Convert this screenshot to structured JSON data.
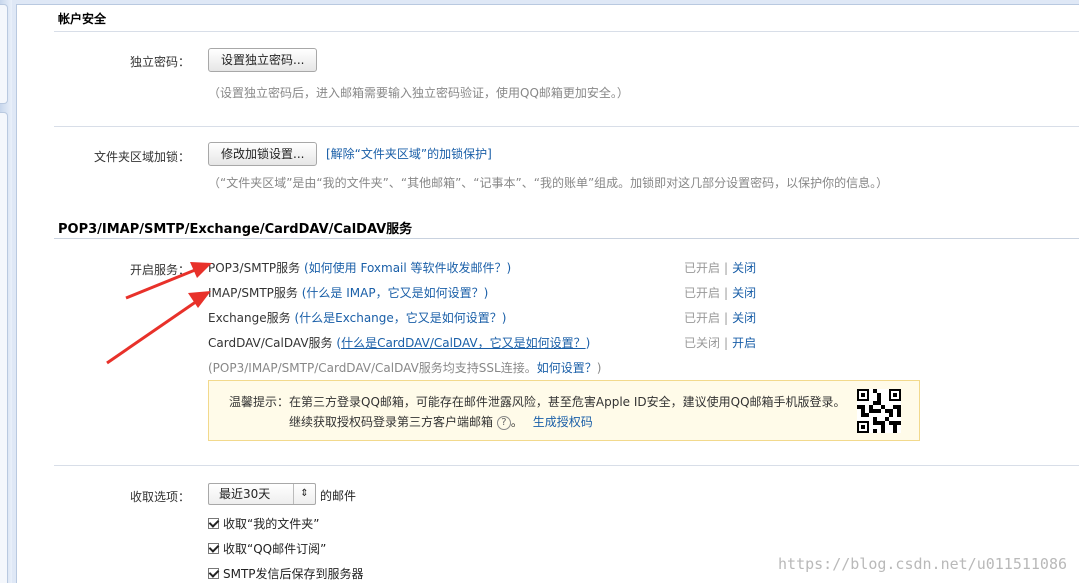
{
  "account_security": {
    "title": "帐户安全",
    "independent_password": {
      "label": "独立密码：",
      "button": "设置独立密码...",
      "hint": "（设置独立密码后，进入邮箱需要输入独立密码验证，使用QQ邮箱更加安全。）"
    },
    "folder_lock": {
      "label": "文件夹区域加锁：",
      "button": "修改加锁设置...",
      "link": "[解除“文件夹区域”的加锁保护]",
      "hint": "（“文件夹区域”是由“我的文件夹”、“其他邮箱”、“记事本”、“我的账单”组成。加锁即对这几部分设置密码，以保护你的信息。）"
    }
  },
  "services": {
    "title": "POP3/IMAP/SMTP/Exchange/CardDAV/CalDAV服务",
    "label": "开启服务：",
    "rows": [
      {
        "name": "POP3/SMTP服务",
        "help": "(如何使用 Foxmail 等软件收发邮件？)",
        "status": "已开启",
        "action": "关闭"
      },
      {
        "name": "IMAP/SMTP服务",
        "help": "(什么是 IMAP，它又是如何设置？)",
        "status": "已开启",
        "action": "关闭"
      },
      {
        "name": "Exchange服务",
        "help": "(什么是Exchange，它又是如何设置？)",
        "status": "已开启",
        "action": "关闭"
      },
      {
        "name": "CardDAV/CalDAV服务",
        "help_prefix": "(",
        "help": "什么是CardDAV/CalDAV，它又是如何设置？",
        "help_suffix": ")",
        "status": "已关闭",
        "action": "开启"
      }
    ],
    "separator": "|",
    "ssl_note": "(POP3/IMAP/SMTP/CardDAV/CalDAV服务均支持SSL连接。",
    "ssl_link": "如何设置？",
    "ssl_note_end": ")",
    "tip": {
      "line1": "温馨提示：在第三方登录QQ邮箱，可能存在邮件泄露风险，甚至危害Apple ID安全，建议使用QQ邮箱手机版登录。",
      "line2": "继续获取授权码登录第三方客户端邮箱",
      "help_icon": "?",
      "period": "。",
      "link": "生成授权码"
    }
  },
  "receive": {
    "label": "收取选项：",
    "select_value": "最近30天",
    "select_suffix": "的邮件",
    "checkboxes": [
      {
        "label": "收取“我的文件夹”",
        "checked": true
      },
      {
        "label": "收取“QQ邮件订阅”",
        "checked": true
      },
      {
        "label": "SMTP发信后保存到服务器",
        "checked": true
      }
    ]
  },
  "watermark": "https://blog.csdn.net/u011511086",
  "colors": {
    "link": "#1a5fa8",
    "arrow": "#e8312a",
    "tip_bg": "#fffbe9"
  }
}
